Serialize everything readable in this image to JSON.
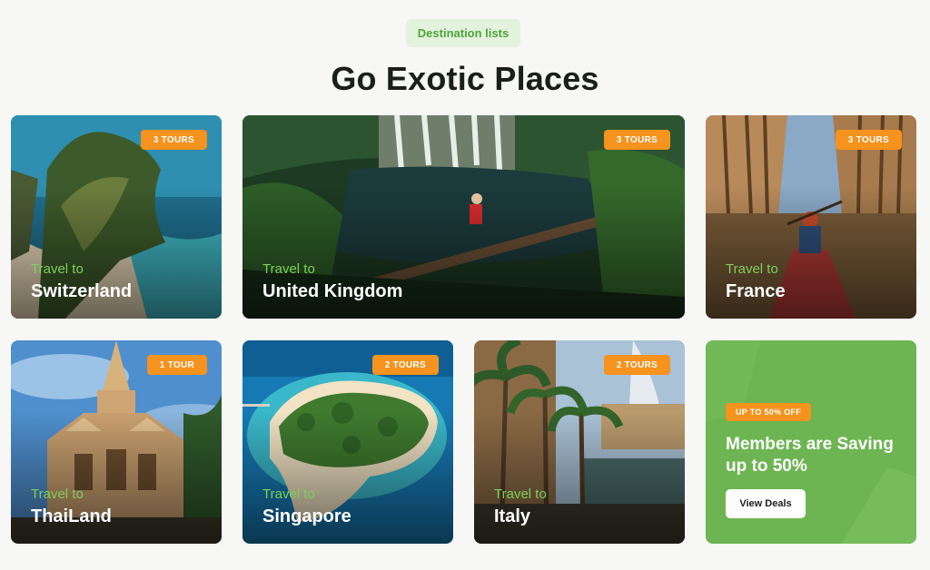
{
  "section": {
    "pill_label": "Destination lists",
    "title": "Go Exotic Places"
  },
  "destinations": [
    {
      "prefix": "Travel to",
      "name": "Switzerland",
      "tours": "3 TOURS"
    },
    {
      "prefix": "Travel to",
      "name": "United Kingdom",
      "tours": "3 TOURS"
    },
    {
      "prefix": "Travel to",
      "name": "France",
      "tours": "3 TOURS"
    },
    {
      "prefix": "Travel to",
      "name": "ThaiLand",
      "tours": "1 TOUR"
    },
    {
      "prefix": "Travel to",
      "name": "Singapore",
      "tours": "2 TOURS"
    },
    {
      "prefix": "Travel to",
      "name": "Italy",
      "tours": "2 TOURS"
    }
  ],
  "promo": {
    "badge": "UP TO 50% OFF",
    "text": "Members are Saving up to 50%",
    "button": "View Deals"
  },
  "colors": {
    "accent_green": "#7dcf5a",
    "badge_orange": "#f6921e",
    "promo_bg": "#6db552",
    "pill_bg": "#e3f2dc"
  }
}
